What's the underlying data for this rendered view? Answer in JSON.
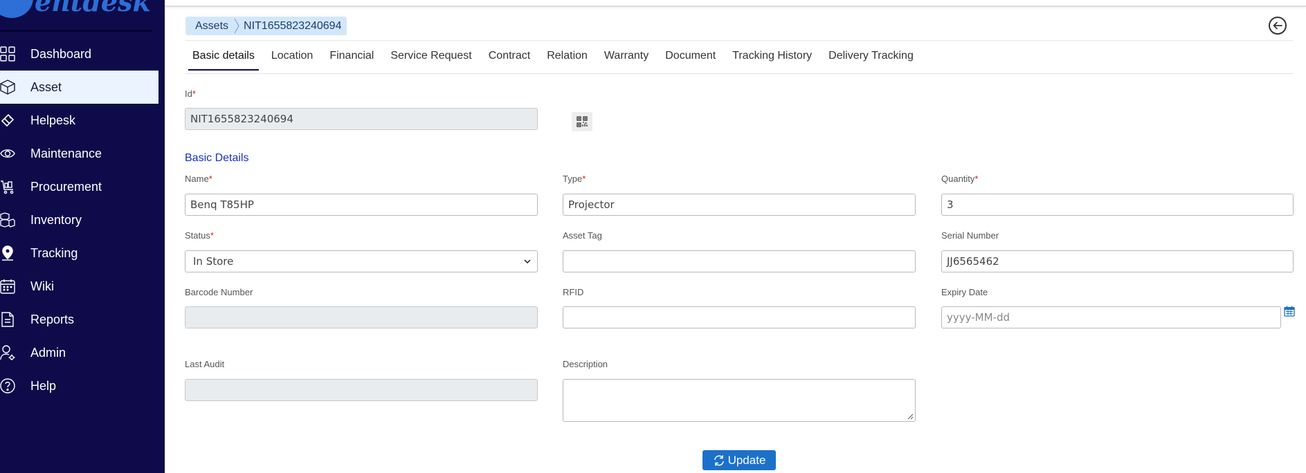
{
  "app": {
    "logo_text": "entdesk"
  },
  "sidebar": {
    "items": [
      {
        "label": "Dashboard",
        "icon": "grid-icon"
      },
      {
        "label": "Asset",
        "icon": "cube-icon",
        "active": true
      },
      {
        "label": "Helpesk",
        "icon": "ticket-icon"
      },
      {
        "label": "Maintenance",
        "icon": "eye-icon"
      },
      {
        "label": "Procurement",
        "icon": "cart-icon"
      },
      {
        "label": "Inventory",
        "icon": "boxes-icon"
      },
      {
        "label": "Tracking",
        "icon": "location-pin-icon"
      },
      {
        "label": "Wiki",
        "icon": "calendar-icon"
      },
      {
        "label": "Reports",
        "icon": "document-icon"
      },
      {
        "label": "Admin",
        "icon": "user-gear-icon"
      },
      {
        "label": "Help",
        "icon": "question-icon"
      }
    ]
  },
  "breadcrumb": {
    "root": "Assets",
    "current": "NIT1655823240694"
  },
  "tabs": [
    {
      "label": "Basic details",
      "active": true
    },
    {
      "label": "Location"
    },
    {
      "label": "Financial"
    },
    {
      "label": "Service Request"
    },
    {
      "label": "Contract"
    },
    {
      "label": "Relation"
    },
    {
      "label": "Warranty"
    },
    {
      "label": "Document"
    },
    {
      "label": "Tracking History"
    },
    {
      "label": "Delivery Tracking"
    }
  ],
  "form": {
    "id_label": "Id",
    "id_value": "NIT1655823240694",
    "section_title": "Basic Details",
    "name_label": "Name",
    "name_value": "Benq T85HP",
    "type_label": "Type",
    "type_value": "Projector",
    "quantity_label": "Quantity",
    "quantity_value": "3",
    "status_label": "Status",
    "status_value": "In Store",
    "asset_tag_label": "Asset Tag",
    "asset_tag_value": "",
    "serial_label": "Serial Number",
    "serial_value": "JJ6565462",
    "barcode_label": "Barcode Number",
    "barcode_value": "",
    "rfid_label": "RFID",
    "rfid_value": "",
    "expiry_label": "Expiry Date",
    "expiry_placeholder": "yyyy-MM-dd",
    "last_audit_label": "Last Audit",
    "last_audit_value": "",
    "description_label": "Description",
    "description_value": "",
    "required_mark": "*"
  },
  "actions": {
    "update_label": "Update"
  },
  "colors": {
    "sidebar_bg": "#0f0b4a",
    "active_item_bg": "#eaf3ff",
    "breadcrumb_bg": "#d3e7fb",
    "section_title": "#1530c9",
    "primary_button": "#1b71c9",
    "required": "#d02020"
  }
}
